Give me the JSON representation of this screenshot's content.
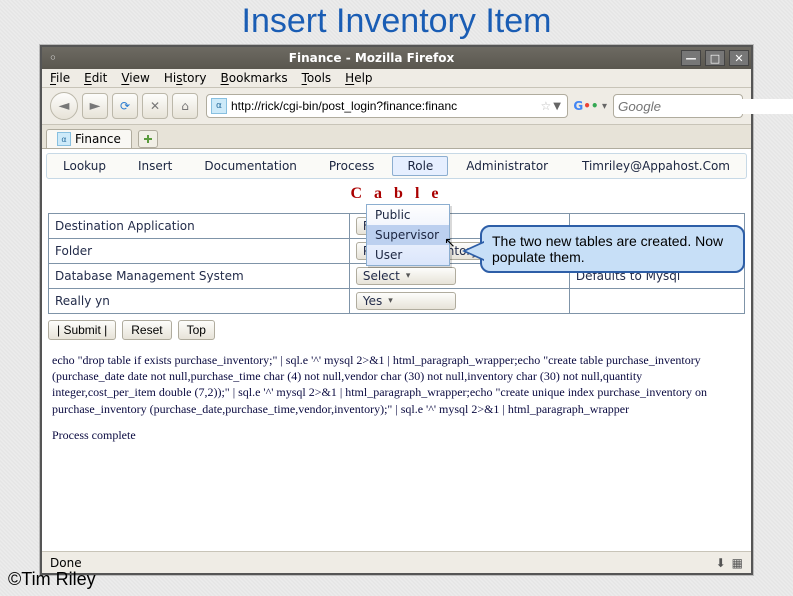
{
  "slide": {
    "title": "Insert Inventory Item",
    "copyright": "©Tim Riley"
  },
  "window": {
    "title": "Finance - Mozilla Firefox",
    "menus": [
      "File",
      "Edit",
      "View",
      "History",
      "Bookmarks",
      "Tools",
      "Help"
    ],
    "url": "http://rick/cgi-bin/post_login?finance:financ",
    "search_placeholder": "Google",
    "tab_label": "Finance",
    "status": "Done"
  },
  "app_menu": {
    "items": [
      "Lookup",
      "Insert",
      "Documentation",
      "Process",
      "Role",
      "Administrator",
      "Timriley@Appahost.Com"
    ],
    "active": "Role"
  },
  "role_dropdown": {
    "items": [
      "Public",
      "Supervisor",
      "User"
    ],
    "highlight": "Supervisor"
  },
  "page_heading_visible": "C                   a  b  l  e",
  "form": {
    "rows": [
      {
        "label": "Destination Application",
        "control": "Finance",
        "defaults": ""
      },
      {
        "label": "Folder",
        "control": "Purchase Inventory",
        "defaults": ""
      },
      {
        "label": "Database Management System",
        "control": "Select",
        "defaults": "Defaults to Mysql"
      },
      {
        "label": "Really yn",
        "control": "Yes",
        "defaults": ""
      }
    ]
  },
  "buttons": {
    "submit": "|   Submit   |",
    "reset": "Reset",
    "top": "Top"
  },
  "output_text": "echo \"drop table if exists purchase_inventory;\" | sql.e '^' mysql 2>&1 | html_paragraph_wrapper;echo \"create table purchase_inventory (purchase_date date not null,purchase_time char (4) not null,vendor char (30) not null,inventory char (30) not null,quantity integer,cost_per_item double (7,2));\" | sql.e '^' mysql 2>&1 | html_paragraph_wrapper;echo \"create unique index purchase_inventory on purchase_inventory (purchase_date,purchase_time,vendor,inventory);\" | sql.e '^' mysql 2>&1 | html_paragraph_wrapper",
  "output_tail": "Process complete",
  "callout_text": "The two new tables are created. Now populate them."
}
